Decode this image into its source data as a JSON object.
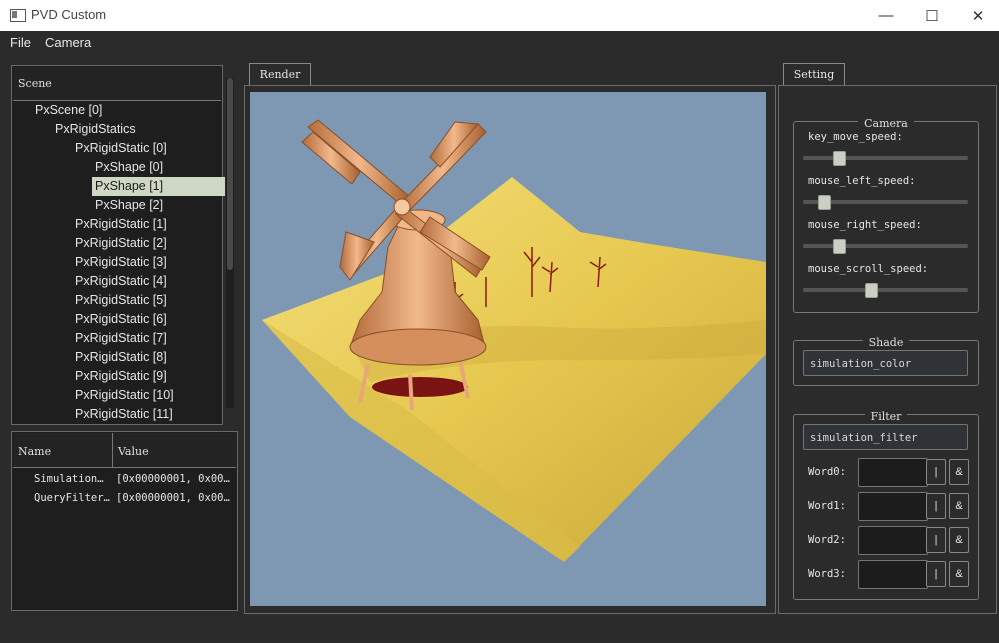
{
  "window": {
    "title": "PVD Custom",
    "minimize_glyph": "—",
    "maximize_glyph": "☐",
    "close_glyph": "✕"
  },
  "menu": {
    "items": [
      "File",
      "Camera"
    ]
  },
  "scene": {
    "header": "Scene",
    "items": [
      {
        "label": "PxScene [0]"
      },
      {
        "label": "PxRigidStatics"
      },
      {
        "label": "PxRigidStatic [0]"
      },
      {
        "label": "PxShape [0]"
      },
      {
        "label": "PxShape [1]"
      },
      {
        "label": "PxShape [2]"
      },
      {
        "label": "PxRigidStatic [1]"
      },
      {
        "label": "PxRigidStatic [2]"
      },
      {
        "label": "PxRigidStatic [3]"
      },
      {
        "label": "PxRigidStatic [4]"
      },
      {
        "label": "PxRigidStatic [5]"
      },
      {
        "label": "PxRigidStatic [6]"
      },
      {
        "label": "PxRigidStatic [7]"
      },
      {
        "label": "PxRigidStatic [8]"
      },
      {
        "label": "PxRigidStatic [9]"
      },
      {
        "label": "PxRigidStatic [10]"
      },
      {
        "label": "PxRigidStatic [11]"
      }
    ],
    "selected": "PxShape [1]"
  },
  "properties": {
    "headers": {
      "name": "Name",
      "value": "Value"
    },
    "rows": [
      {
        "name": "Simulation…",
        "value": "[0x00000001, 0x00…"
      },
      {
        "name": "QueryFilter…",
        "value": "[0x00000001, 0x00…"
      }
    ]
  },
  "render": {
    "tab_label": "Render"
  },
  "settings": {
    "tab_label": "Setting",
    "camera": {
      "title": "Camera",
      "sliders": [
        {
          "label": "key_move_speed:",
          "value": 0.22
        },
        {
          "label": "mouse_left_speed:",
          "value": 0.13
        },
        {
          "label": "mouse_right_speed:",
          "value": 0.22
        },
        {
          "label": "mouse_scroll_speed:",
          "value": 0.41
        }
      ]
    },
    "shade": {
      "title": "Shade",
      "value": "simulation_color"
    },
    "filter": {
      "title": "Filter",
      "value": "simulation_filter",
      "words": [
        {
          "label": "Word0:",
          "or_label": "|",
          "and_label": "&"
        },
        {
          "label": "Word1:",
          "or_label": "|",
          "and_label": "&"
        },
        {
          "label": "Word2:",
          "or_label": "|",
          "and_label": "&"
        },
        {
          "label": "Word3:",
          "or_label": "|",
          "and_label": "&"
        }
      ]
    }
  },
  "colors": {
    "viewport_bg": "#7e98b4",
    "terrain": "#e8cf5e",
    "windmill": "#e8a77a",
    "selection": "#cfd8c5"
  }
}
